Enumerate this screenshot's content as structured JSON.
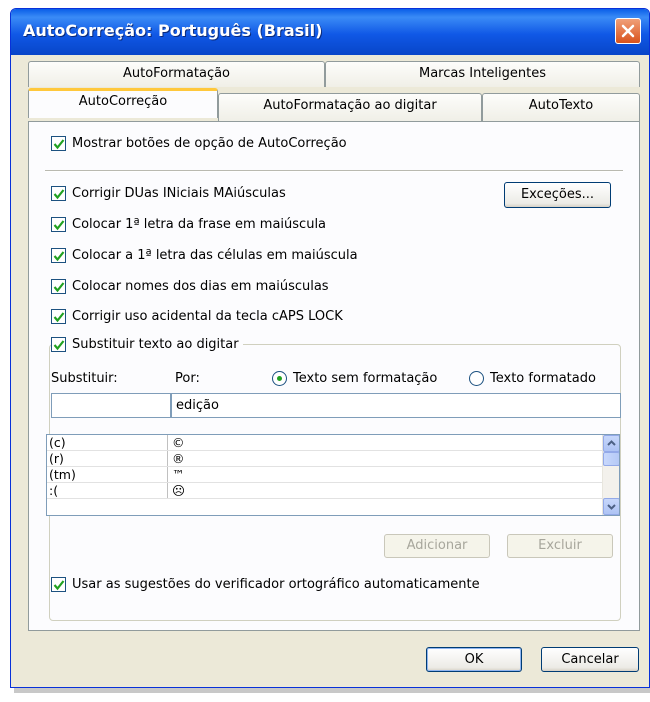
{
  "window": {
    "title": "AutoCorreção: Português (Brasil)"
  },
  "tabs": {
    "back_row": [
      "AutoFormatação",
      "Marcas Inteligentes"
    ],
    "front_row": [
      "AutoCorreção",
      "AutoFormatação ao digitar",
      "AutoTexto"
    ],
    "active": "AutoCorreção"
  },
  "options": {
    "show_buttons": {
      "label": "Mostrar botões de opção de AutoCorreção",
      "checked": true
    },
    "two_initials": {
      "label": "Corrigir DUas INiciais MAiúsculas",
      "checked": true
    },
    "sentence_first": {
      "label": "Colocar 1ª letra da frase em maiúscula",
      "checked": true
    },
    "cell_first": {
      "label": "Colocar a 1ª letra das células em maiúscula",
      "checked": true
    },
    "day_names": {
      "label": "Colocar nomes dos dias em maiúsculas",
      "checked": true
    },
    "caps_lock": {
      "label": "Corrigir uso acidental da tecla cAPS LOCK",
      "checked": true
    },
    "replace_text": {
      "label": "Substituir texto ao digitar",
      "checked": true
    },
    "spell_suggestions": {
      "label": "Usar as sugestões do verificador ortográfico automaticamente",
      "checked": true
    }
  },
  "buttons": {
    "exceptions": "Exceções...",
    "add": "Adicionar",
    "delete": "Excluir",
    "ok": "OK",
    "cancel": "Cancelar"
  },
  "replace": {
    "substituir_label": "Substituir:",
    "por_label": "Por:",
    "plain_text_label": "Texto sem formatação",
    "formatted_text_label": "Texto formatado",
    "selected_format": "plain",
    "substituir_value": "",
    "por_value": "edição"
  },
  "entries": [
    {
      "from": "(c)",
      "to": "©"
    },
    {
      "from": "(r)",
      "to": "®"
    },
    {
      "from": "(tm)",
      "to": "™"
    },
    {
      "from": ":(",
      "to": "☹"
    }
  ],
  "colors": {
    "title_bar": "#0a5ee8",
    "active_tab_accent": "#ffc83c",
    "check": "#21a121"
  }
}
